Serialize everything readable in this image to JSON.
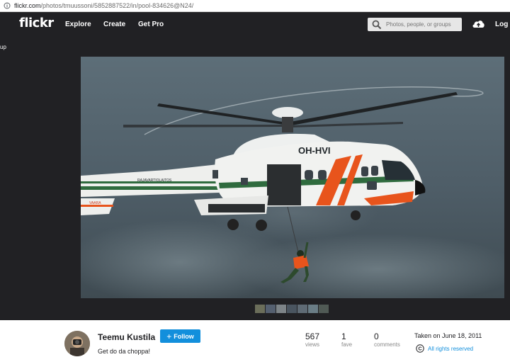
{
  "browser": {
    "url_host": "flickr.com",
    "url_path": "/photos/tmuussoni/5852887522/in/pool-834626@N24/"
  },
  "nav": {
    "logo": "flickr",
    "links": [
      "Explore",
      "Create",
      "Get Pro"
    ],
    "search_placeholder": "Photos, people, or groups",
    "login": "Log I"
  },
  "stage": {
    "back_label": "up",
    "photo": {
      "registration": "OH-HVI",
      "fuselage_text": "RAJAVARTIOLAITOS",
      "tail_text": "VAARA"
    },
    "thumbnail_count": 7
  },
  "owner": {
    "name": "Teemu Kustila",
    "follow_label": "Follow",
    "description": "Get do da choppa!"
  },
  "stats": [
    {
      "value": "567",
      "label": "views"
    },
    {
      "value": "1",
      "label": "fave"
    },
    {
      "value": "0",
      "label": "comments"
    }
  ],
  "meta": {
    "taken": "Taken on June 18, 2011",
    "rights": "All rights reserved"
  },
  "colors": {
    "nav_bg": "#212124",
    "accent": "#128fdc",
    "helicopter_orange": "#e8541c",
    "helicopter_green": "#2f6b3e"
  }
}
